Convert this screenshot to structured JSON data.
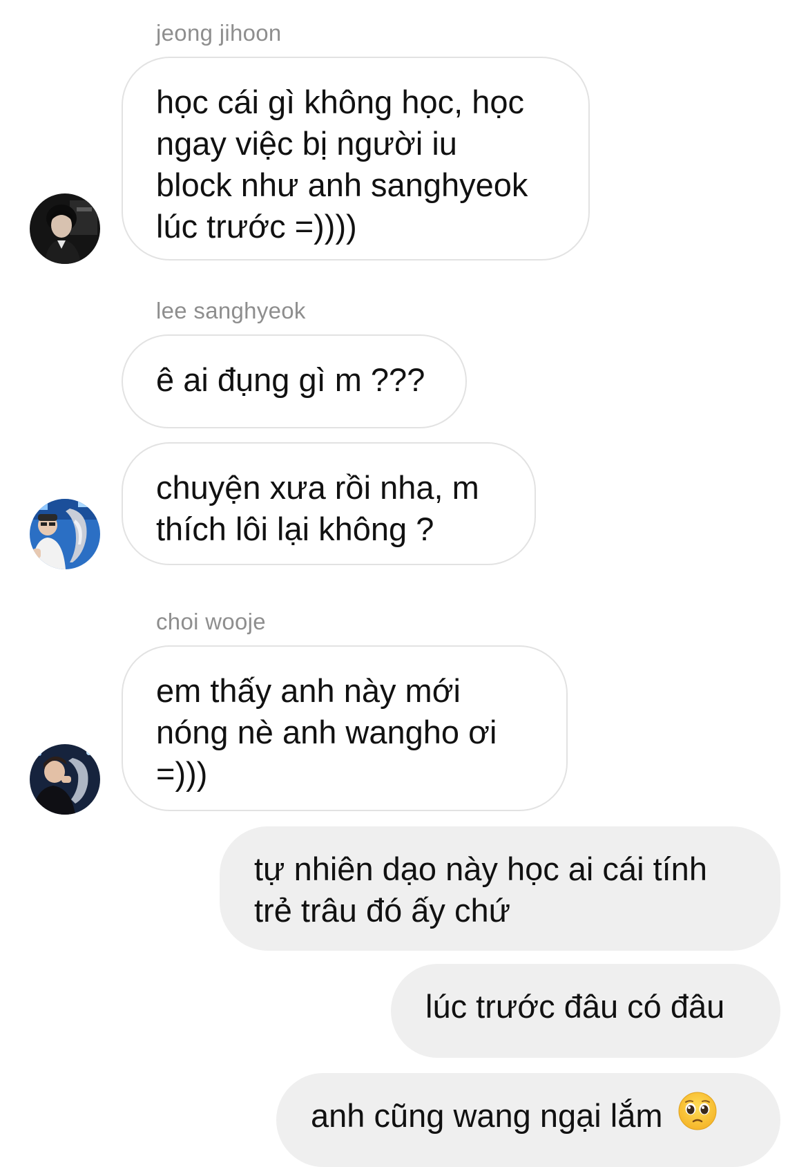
{
  "thread": {
    "groups": [
      {
        "sender": "jeong jihoon",
        "avatar_icon": "avatar-dark-portrait",
        "messages": [
          "học cái gì không học, học\nngay việc bị người iu\nblock như anh sanghyeok\nlúc trước =))))"
        ]
      },
      {
        "sender": "lee sanghyeok",
        "avatar_icon": "avatar-trophy-photo",
        "messages": [
          "ê ai đụng gì m ???",
          "chuyện xưa rồi nha, m\nthích lôi lại không ?"
        ]
      },
      {
        "sender": "choi wooje",
        "avatar_icon": "avatar-celebration-photo",
        "messages": [
          "em thấy anh này mới\nnóng nè anh wangho ơi\n=)))"
        ]
      }
    ],
    "outgoing": [
      "tự nhiên dạo này học ai cái tính\ntrẻ trâu đó ấy chứ",
      "lúc trước đâu có đâu",
      "anh cũng wang ngại lắm"
    ],
    "emoji_icon": "pleading-face-emoji"
  }
}
